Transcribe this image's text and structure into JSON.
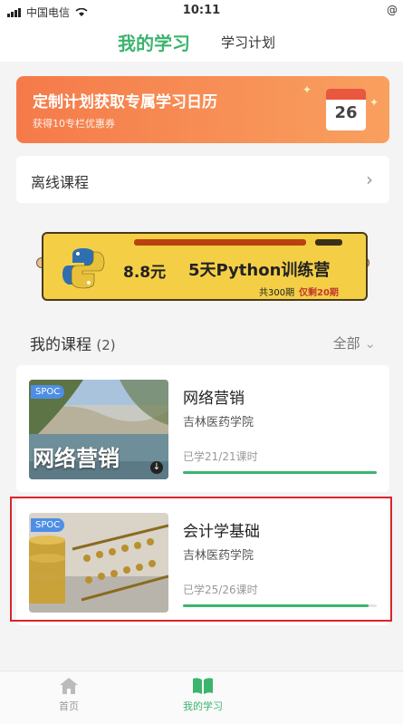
{
  "status_bar": {
    "carrier": "中国电信",
    "time": "10:11",
    "right_text": "@"
  },
  "top_nav": {
    "tabs": [
      {
        "label": "我的学习",
        "active": true
      },
      {
        "label": "学习计划",
        "active": false
      }
    ]
  },
  "banner": {
    "title": "定制计划获取专属学习日历",
    "subtitle": "获得10专栏优惠券",
    "calendar_day": "26"
  },
  "offline": {
    "label": "离线课程",
    "icon": "chevron-right-icon"
  },
  "promo": {
    "price": "8.8元",
    "title": "5天Python训练营",
    "sub1": "共300期",
    "sub2": "仅剩20期"
  },
  "my_courses": {
    "title": "我的课程",
    "count": "(2)",
    "filter_label": "全部"
  },
  "courses": [
    {
      "badge": "SPOC",
      "thumb_text": "网络营销",
      "title": "网络营销",
      "school": "吉林医药学院",
      "progress_text": "已学21/21课时",
      "progress": 1.0
    },
    {
      "badge": "SPOC",
      "thumb_text": "",
      "title": "会计学基础",
      "school": "吉林医药学院",
      "progress_text": "已学25/26课时",
      "progress": 0.96
    }
  ],
  "tab_bar": {
    "items": [
      {
        "label": "首页",
        "icon": "home-icon"
      },
      {
        "label": "我的学习",
        "icon": "book-icon",
        "active": true
      }
    ]
  },
  "colors": {
    "accent": "#3cb46e",
    "banner": "#f57a4a",
    "highlight": "#d8262c"
  }
}
